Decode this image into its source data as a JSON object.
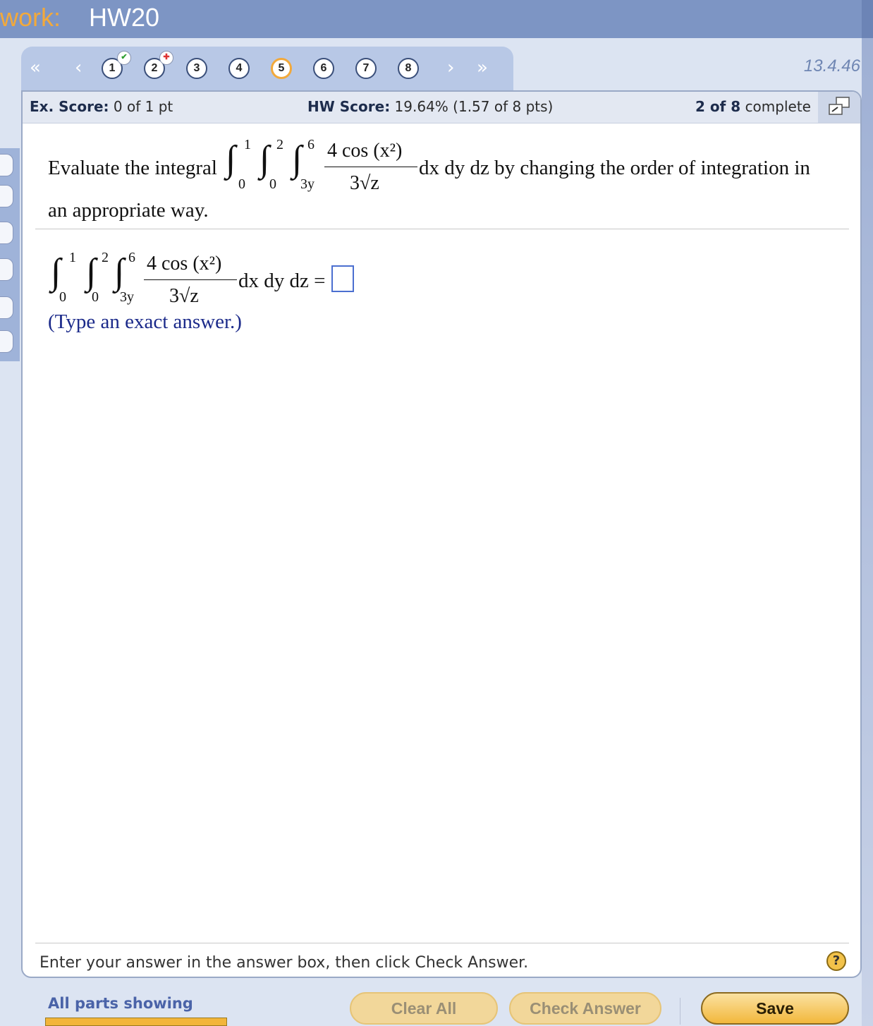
{
  "window": {
    "title_prefix": "work:",
    "title": "HW20"
  },
  "nav": {
    "first_arrow": "«",
    "prev_arrow": "‹",
    "next_arrow": "›",
    "last_arrow": "»",
    "questions": [
      {
        "label": "1",
        "status": "correct"
      },
      {
        "label": "2",
        "status": "partial"
      },
      {
        "label": "3",
        "status": "none"
      },
      {
        "label": "4",
        "status": "none"
      },
      {
        "label": "5",
        "status": "current"
      },
      {
        "label": "6",
        "status": "none"
      },
      {
        "label": "7",
        "status": "none"
      },
      {
        "label": "8",
        "status": "none"
      }
    ],
    "question_id": "13.4.46"
  },
  "scores": {
    "ex_label": "Ex. Score:",
    "ex_value": "0 of 1 pt",
    "hw_label": "HW Score:",
    "hw_value": "19.64% (1.57 of 8 pts)",
    "complete_bold": "2 of 8",
    "complete_text": "complete"
  },
  "question": {
    "prefix": "Evaluate the integral",
    "suffix": "dx dy dz by changing the order of integration in",
    "line2": "an appropriate way.",
    "int1_upper": "1",
    "int1_lower": "0",
    "int2_upper": "2",
    "int2_lower": "0",
    "int3_upper": "6",
    "int3_lower": "3y",
    "numerator": "4 cos (x²)",
    "denominator": "3√z",
    "answer_suffix": "dx dy dz =",
    "hint": "(Type an exact answer.)"
  },
  "instruction": "Enter your answer in the answer box, then click Check Answer.",
  "footer": {
    "parts": "All parts showing",
    "clear_all": "Clear All",
    "check_answer": "Check Answer",
    "save": "Save"
  },
  "colors": {
    "accent": "#f2a93b",
    "nav_bg": "#b8c8e6",
    "title_bg": "#7d95c4",
    "hint": "#1b2a8a"
  }
}
